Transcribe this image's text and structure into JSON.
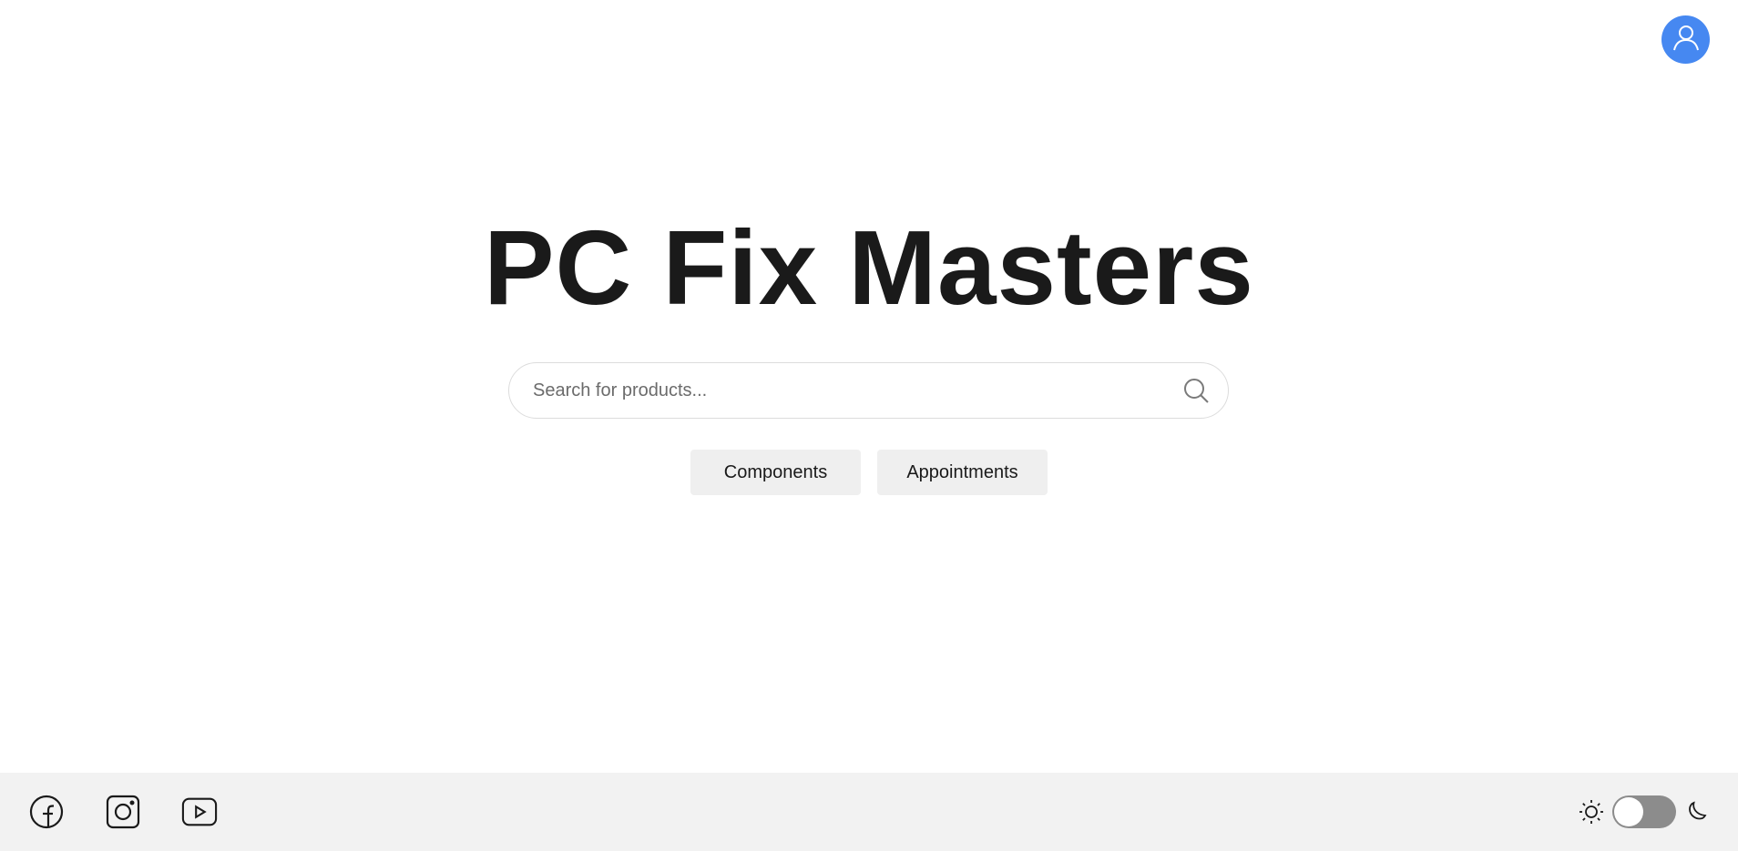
{
  "header": {
    "avatar_icon": "user-icon",
    "avatar_color": "#4688f1"
  },
  "hero": {
    "title": "PC Fix Masters"
  },
  "search": {
    "placeholder": "Search for products...",
    "value": "",
    "icon": "search-icon"
  },
  "nav": {
    "components_label": "Components",
    "appointments_label": "Appointments"
  },
  "footer": {
    "background": "#f2f2f2",
    "socials": [
      {
        "icon": "facebook-icon"
      },
      {
        "icon": "instagram-icon"
      },
      {
        "icon": "youtube-icon"
      }
    ],
    "theme": {
      "light_icon": "sun-icon",
      "dark_icon": "moon-icon",
      "dark_mode": false,
      "toggle_color": "#8c8c8c"
    }
  }
}
